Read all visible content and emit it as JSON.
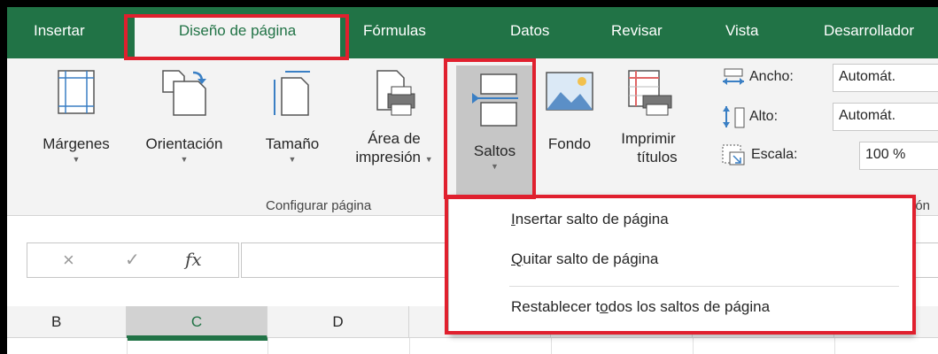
{
  "tabs": [
    "Insertar",
    "Diseño de página",
    "Fórmulas",
    "Datos",
    "Revisar",
    "Vista",
    "Desarrollador"
  ],
  "ribbon": {
    "buttons": {
      "margenes": "Márgenes",
      "orientacion": "Orientación",
      "tamano": "Tamaño",
      "area_line1": "Área de",
      "area_line2": "impresión",
      "saltos": "Saltos",
      "fondo": "Fondo",
      "imprimir_line1": "Imprimir",
      "imprimir_line2": "títulos"
    },
    "group_label": "Configurar página",
    "group_label_cut": "ión",
    "scale": {
      "ancho_label": "Ancho:",
      "ancho_value": "Automát.",
      "alto_label": "Alto:",
      "alto_value": "Automát.",
      "escala_label": "Escala:",
      "escala_value": "100 %"
    }
  },
  "formula_bar": {
    "cancel_icon": "×",
    "enter_icon": "✓",
    "fx_label": "fx"
  },
  "columns": [
    "B",
    "C",
    "D"
  ],
  "menu": {
    "items": [
      {
        "pre": "",
        "u": "I",
        "post": "nsertar salto de página"
      },
      {
        "pre": "",
        "u": "Q",
        "post": "uitar salto de página"
      },
      {
        "pre": "Restablecer t",
        "u": "o",
        "post": "dos los saltos de página"
      }
    ]
  },
  "colors": {
    "accent": "#217346",
    "highlight": "#e0202e"
  }
}
